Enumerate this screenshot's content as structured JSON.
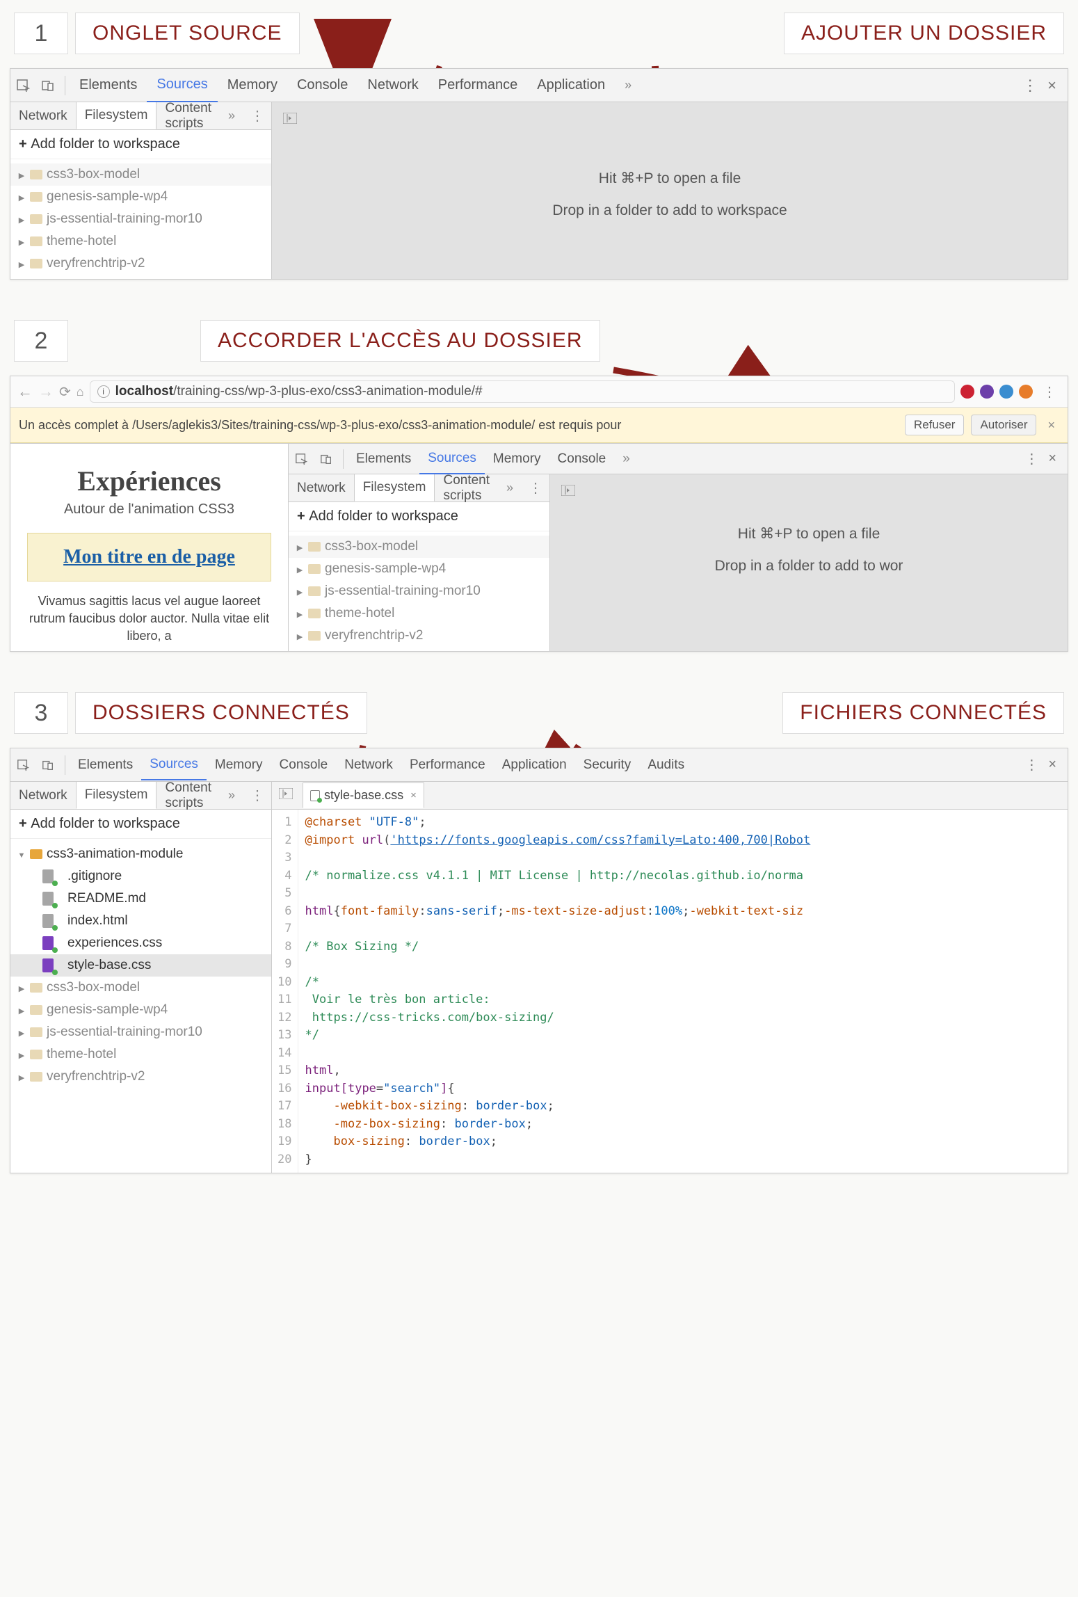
{
  "steps": {
    "s1": {
      "num": "1",
      "label_a": "ONGLET SOURCE",
      "label_b": "AJOUTER UN DOSSIER"
    },
    "s2": {
      "num": "2",
      "label": "ACCORDER L'ACCÈS AU DOSSIER"
    },
    "s3": {
      "num": "3",
      "label_a": "DOSSIERS CONNECTÉS",
      "label_b": "FICHIERS CONNECTÉS"
    }
  },
  "devtabs": {
    "elements": "Elements",
    "sources": "Sources",
    "memory": "Memory",
    "console": "Console",
    "network": "Network",
    "performance": "Performance",
    "application": "Application",
    "security": "Security",
    "audits": "Audits",
    "more": "»"
  },
  "subtabs": {
    "network": "Network",
    "filesystem": "Filesystem",
    "contentscripts": "Content scripts",
    "more": "»"
  },
  "fs": {
    "add": "Add folder to workspace",
    "hint1": "Hit ⌘+P to open a file",
    "hint2": "Drop in a folder to add to workspace",
    "hint2_short": "Drop in a folder to add to wor",
    "folders": {
      "a": "css3-box-model",
      "b": "genesis-sample-wp4",
      "c": "js-essential-training-mor10",
      "d": "theme-hotel",
      "e": "veryfrenchtrip-v2",
      "anim": "css3-animation-module"
    },
    "files": {
      "gitignore": ".gitignore",
      "readme": "README.md",
      "index": "index.html",
      "exp": "experiences.css",
      "style": "style-base.css"
    }
  },
  "browser": {
    "host": "localhost",
    "path": "/training-css/wp-3-plus-exo/css3-animation-module/#"
  },
  "perm": {
    "msg": "Un accès complet à /Users/aglekis3/Sites/training-css/wp-3-plus-exo/css3-animation-module/ est requis pour",
    "refuse": "Refuser",
    "allow": "Autoriser",
    "close": "×"
  },
  "page": {
    "title": "Expériences",
    "sub": "Autour de l'animation CSS3",
    "link": "Mon titre en de page",
    "body": "Vivamus sagittis lacus vel augue laoreet rutrum faucibus dolor auctor. Nulla vitae elit libero, a"
  },
  "code": {
    "tab": "style-base.css",
    "lines": [
      "1",
      "2",
      "3",
      "4",
      "5",
      "6",
      "7",
      "8",
      "9",
      "10",
      "11",
      "12",
      "13",
      "14",
      "15",
      "16",
      "17",
      "18",
      "19",
      "20"
    ]
  }
}
